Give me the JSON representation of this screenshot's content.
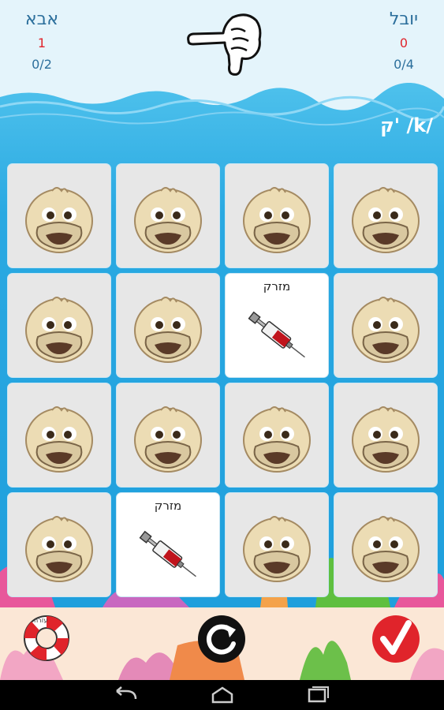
{
  "players": {
    "left": {
      "name": "אבא",
      "score": "1",
      "pairs": "0/2"
    },
    "right": {
      "name": "יובל",
      "score": "0",
      "pairs": "0/4"
    }
  },
  "letter_prompt": "ק' /k/",
  "open_card_word": "מזרק",
  "icons": {
    "turn": "pointing-hand-icon",
    "card_back": "duck-icon",
    "card_face": "syringe-icon",
    "help": "life-ring-icon",
    "restart": "restart-icon",
    "confirm": "checkmark-icon",
    "nav": [
      "back-icon",
      "home-icon",
      "recent-apps-icon"
    ]
  },
  "colors": {
    "score": "#e0242b",
    "name": "#2c6f9c",
    "sea": "#2ba8e0",
    "confirm": "#e0242b"
  },
  "help_label": "עזרה"
}
